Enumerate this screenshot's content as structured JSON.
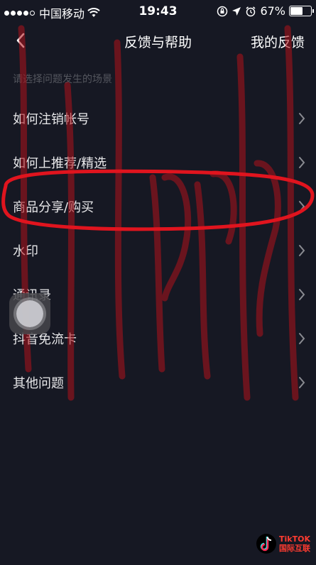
{
  "status": {
    "carrier": "中国移动",
    "time": "19:43",
    "battery": "67%",
    "battery_level": 0.67
  },
  "nav": {
    "title": "反馈与帮助",
    "right_label": "我的反馈"
  },
  "section_hint": "请选择问题发生的场景",
  "items": [
    {
      "label": "如何注销帐号"
    },
    {
      "label": "如何上推荐/精选"
    },
    {
      "label": "商品分享/购买"
    },
    {
      "label": "水印"
    },
    {
      "label": "通讯录"
    },
    {
      "label": "抖音免流卡"
    },
    {
      "label": "其他问题"
    }
  ],
  "watermark": {
    "line1": "TikTOK",
    "line2": "国际互联"
  },
  "colors": {
    "background": "#161823",
    "annotation": "#e0141e"
  }
}
